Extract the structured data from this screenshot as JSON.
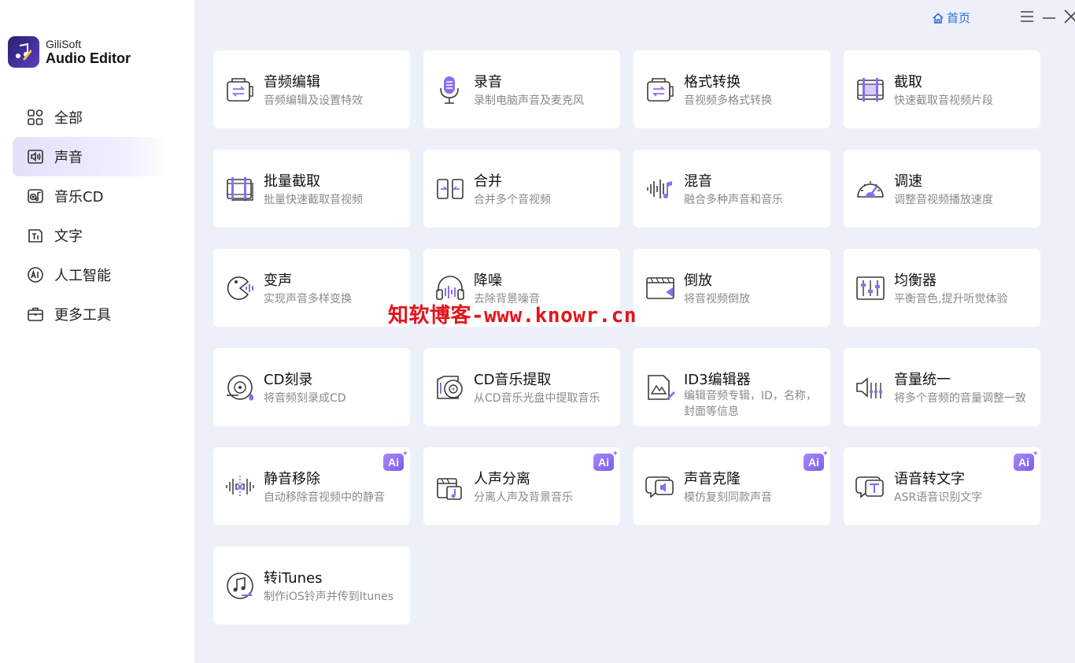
{
  "app": {
    "brand": "GiliSoft",
    "product": "Audio Editor"
  },
  "topbar": {
    "home_label": "首页"
  },
  "sidebar": {
    "items": [
      {
        "label": "全部",
        "icon": "grid-icon"
      },
      {
        "label": "声音",
        "icon": "speaker-icon",
        "active": true
      },
      {
        "label": "音乐CD",
        "icon": "music-cd-icon"
      },
      {
        "label": "文字",
        "icon": "text-icon"
      },
      {
        "label": "人工智能",
        "icon": "ai-icon"
      },
      {
        "label": "更多工具",
        "icon": "toolbox-icon"
      }
    ]
  },
  "tools": [
    {
      "title": "音频编辑",
      "desc": "音频编辑及设置特效",
      "icon": "audio-edit-icon"
    },
    {
      "title": "录音",
      "desc": "录制电脑声音及麦克风",
      "icon": "microphone-icon"
    },
    {
      "title": "格式转换",
      "desc": "音视频多格式转换",
      "icon": "format-convert-icon"
    },
    {
      "title": "截取",
      "desc": "快速截取音视频片段",
      "icon": "trim-icon"
    },
    {
      "title": "批量截取",
      "desc": "批量快速截取音视频",
      "icon": "batch-trim-icon"
    },
    {
      "title": "合并",
      "desc": "合并多个音视频",
      "icon": "merge-icon"
    },
    {
      "title": "混音",
      "desc": "融合多种声音和音乐",
      "icon": "mix-icon"
    },
    {
      "title": "调速",
      "desc": "调整音视频播放速度",
      "icon": "speed-gauge-icon"
    },
    {
      "title": "变声",
      "desc": "实现声音多样变换",
      "icon": "voice-change-icon"
    },
    {
      "title": "降噪",
      "desc": "去除背景噪音",
      "icon": "headphones-icon"
    },
    {
      "title": "倒放",
      "desc": "将音视频倒放",
      "icon": "reverse-icon"
    },
    {
      "title": "均衡器",
      "desc": "平衡音色,提升听觉体验",
      "icon": "equalizer-icon"
    },
    {
      "title": "CD刻录",
      "desc": "将音频刻录成CD",
      "icon": "cd-burn-icon"
    },
    {
      "title": "CD音乐提取",
      "desc": "从CD音乐光盘中提取音乐",
      "icon": "cd-extract-icon"
    },
    {
      "title": "ID3编辑器",
      "desc": "编辑音频专辑，ID，名称，封面等信息",
      "icon": "id3-edit-icon"
    },
    {
      "title": "音量统一",
      "desc": "将多个音频的音量调整一致",
      "icon": "volume-normalize-icon"
    },
    {
      "title": "静音移除",
      "desc": "自动移除音视频中的静音",
      "icon": "silence-remove-icon",
      "ai": true
    },
    {
      "title": "人声分离",
      "desc": "分离人声及背景音乐",
      "icon": "vocal-separate-icon",
      "ai": true
    },
    {
      "title": "声音克隆",
      "desc": "模仿复刻同款声音",
      "icon": "voice-clone-icon",
      "ai": true
    },
    {
      "title": "语音转文字",
      "desc": "ASR语音识别文字",
      "icon": "speech-to-text-icon",
      "ai": true
    },
    {
      "title": "转iTunes",
      "desc": "制作iOS铃声并传到Itunes",
      "icon": "itunes-icon"
    }
  ],
  "ai_badge": "Ai",
  "watermark": "知软博客-www.knowr.cn",
  "colors": {
    "accent": "#7c5ce6",
    "link": "#2b6fe0",
    "background": "#eef0f9"
  }
}
